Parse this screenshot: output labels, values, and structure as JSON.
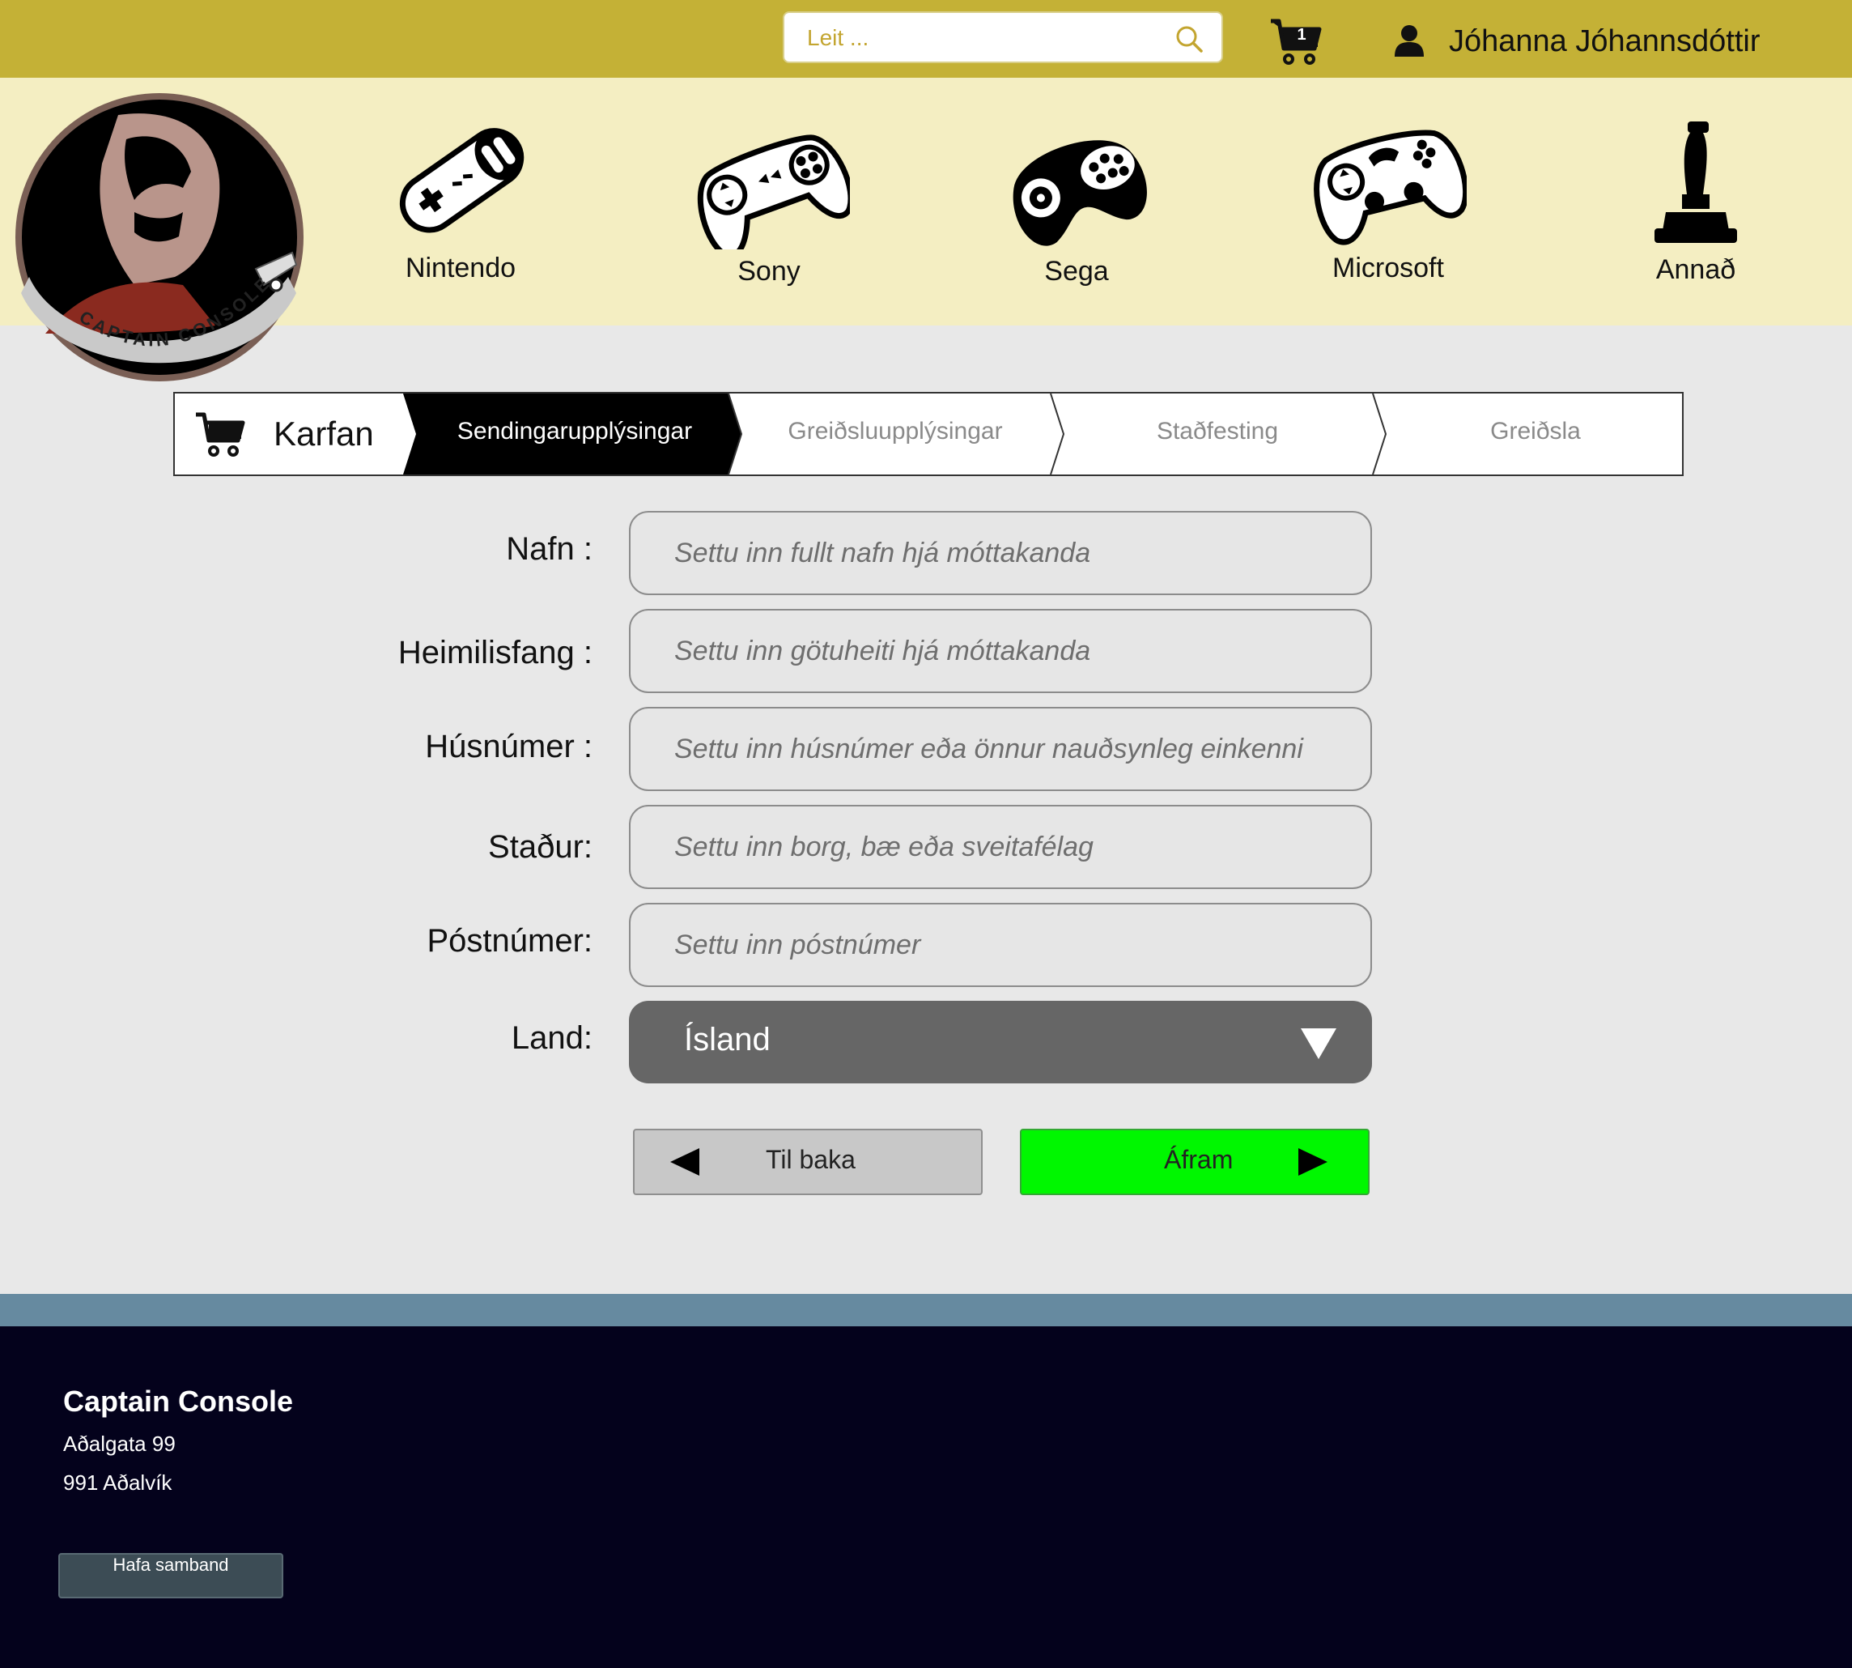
{
  "header": {
    "search_placeholder": "Leit ...",
    "cart_count": "1",
    "user_name": "Jóhanna Jóhannsdóttir"
  },
  "logo": {
    "text": "CAPTAIN CONSOLE"
  },
  "categories": [
    {
      "label": "Nintendo",
      "icon": "snes-controller-icon"
    },
    {
      "label": "Sony",
      "icon": "playstation-controller-icon"
    },
    {
      "label": "Sega",
      "icon": "sega-controller-icon"
    },
    {
      "label": "Microsoft",
      "icon": "xbox-controller-icon"
    },
    {
      "label": "Annað",
      "icon": "joystick-icon"
    }
  ],
  "stepper": {
    "cart_label": "Karfan",
    "steps": [
      {
        "label": "Sendingarupplýsingar",
        "active": true
      },
      {
        "label": "Greiðsluupplýsingar",
        "active": false
      },
      {
        "label": "Staðfesting",
        "active": false
      },
      {
        "label": "Greiðsla",
        "active": false
      }
    ]
  },
  "form": {
    "fields": [
      {
        "label": "Nafn :",
        "placeholder": "Settu inn fullt nafn hjá móttakanda",
        "value": ""
      },
      {
        "label": "Heimilisfang :",
        "placeholder": "Settu inn götuheiti hjá móttakanda",
        "value": ""
      },
      {
        "label": "Húsnúmer :",
        "placeholder": "Settu inn húsnúmer eða önnur nauðsynleg einkenni",
        "value": ""
      },
      {
        "label": "Staður:",
        "placeholder": "Settu inn borg, bæ eða sveitafélag",
        "value": ""
      },
      {
        "label": "Póstnúmer:",
        "placeholder": "Settu inn póstnúmer",
        "value": ""
      }
    ],
    "country": {
      "label": "Land:",
      "selected": "Ísland"
    }
  },
  "buttons": {
    "back": "Til baka",
    "next": "Áfram"
  },
  "footer": {
    "title": "Captain Console",
    "address_line1": "Aðalgata 99",
    "address_line2": "991 Aðalvík",
    "contact_button": "Hafa samband"
  },
  "colors": {
    "topbar": "#c4b136",
    "category_band": "#f4eec2",
    "active_step": "#000000",
    "next_button": "#00f700",
    "footer": "#04021c",
    "footer_stripe": "#668aa0"
  }
}
